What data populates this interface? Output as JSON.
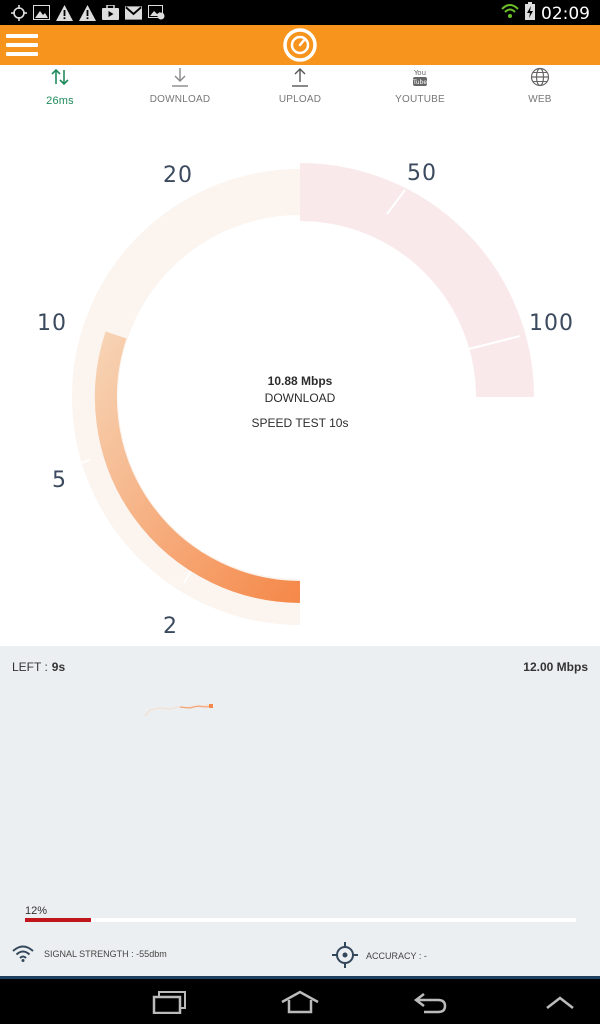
{
  "status_bar": {
    "time": "02:09",
    "icons": [
      "gps-icon",
      "image-icon",
      "warning-icon",
      "warning-icon",
      "video-icon",
      "gmail-icon",
      "image-check-icon"
    ]
  },
  "app_bar": {
    "menu_icon": "hamburger-icon",
    "logo_icon": "speedometer-logo-icon",
    "accent": "#f7941d"
  },
  "tabs": [
    {
      "label": "26ms",
      "icon": "ping-arrows-icon",
      "active": true
    },
    {
      "label": "DOWNLOAD",
      "icon": "download-icon",
      "active": false
    },
    {
      "label": "UPLOAD",
      "icon": "upload-icon",
      "active": false
    },
    {
      "label": "YOUTUBE",
      "icon": "youtube-icon",
      "active": false
    },
    {
      "label": "WEB",
      "icon": "globe-icon",
      "active": false
    }
  ],
  "gauge": {
    "scale": [
      "2",
      "5",
      "10",
      "20",
      "50",
      "100"
    ],
    "speed": "10.88 Mbps",
    "mode": "DOWNLOAD",
    "test_label": "SPEED TEST 10s",
    "fill_color": "#f5894a"
  },
  "panel": {
    "left_label": "LEFT :",
    "left_value": "9s",
    "max_speed": "12.00 Mbps",
    "progress_label": "12%",
    "progress": 0.12,
    "progress_color": "#c0161b",
    "signal": "SIGNAL STRENGTH : -55dbm",
    "accuracy": "ACCURACY : -"
  },
  "nav": {
    "icons": [
      "recent-apps-icon",
      "home-icon",
      "back-icon",
      "up-chevron-icon"
    ]
  }
}
